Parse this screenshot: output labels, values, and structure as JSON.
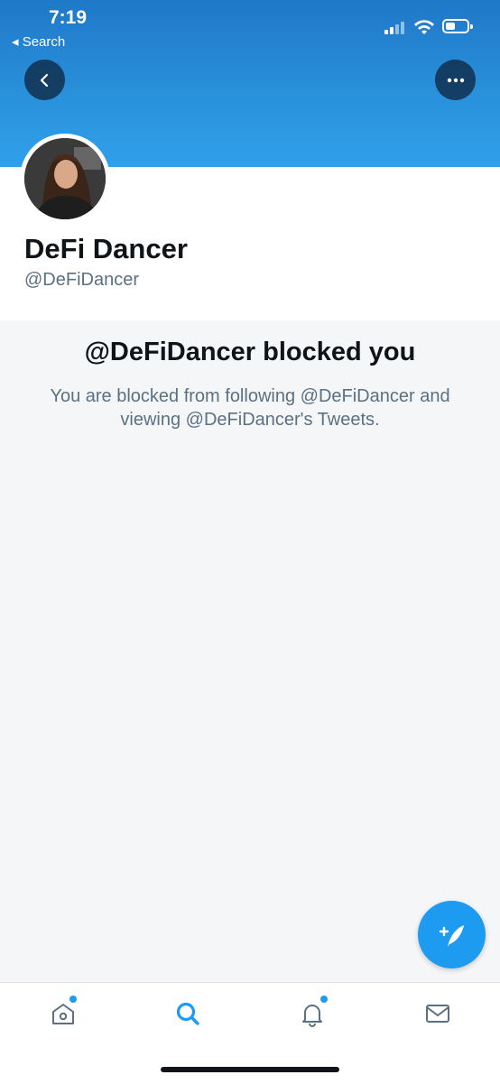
{
  "status_bar": {
    "time": "7:19",
    "back_label": "◂ Search"
  },
  "profile": {
    "display_name": "DeFi Dancer",
    "handle": "@DeFiDancer"
  },
  "blocked": {
    "title": "@DeFiDancer blocked you",
    "message": "You are blocked from following @DeFiDancer and viewing @DeFiDancer's Tweets."
  },
  "tab_bar": {
    "items": [
      {
        "icon": "home-icon",
        "has_dot": true
      },
      {
        "icon": "search-icon",
        "active": true
      },
      {
        "icon": "bell-icon",
        "has_dot": true
      },
      {
        "icon": "mail-icon"
      }
    ]
  },
  "fab": {
    "icon": "compose-tweet-icon"
  },
  "colors": {
    "accent": "#1d9bf0",
    "banner": "#2a92dc",
    "secondary_text": "#5b7083"
  }
}
